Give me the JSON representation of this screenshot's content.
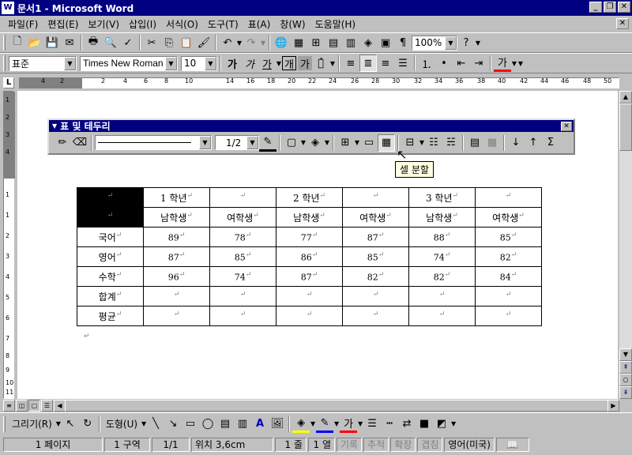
{
  "window": {
    "title": "문서1 - Microsoft Word",
    "app_icon": "W"
  },
  "menu": [
    "파일(F)",
    "편집(E)",
    "보기(V)",
    "삽입(I)",
    "서식(O)",
    "도구(T)",
    "표(A)",
    "창(W)",
    "도움말(H)"
  ],
  "standard_toolbar": {
    "zoom": "100%"
  },
  "format_toolbar": {
    "style": "표준",
    "font": "Times New Roman",
    "size": "10",
    "bold": "가",
    "italic": "가",
    "underline": "가",
    "char_border": "개",
    "char_shade": "가"
  },
  "ruler": [
    "4",
    "2",
    "2",
    "4",
    "6",
    "8",
    "10",
    "14",
    "16",
    "18",
    "20",
    "22",
    "24",
    "26",
    "28",
    "30",
    "32",
    "34",
    "36",
    "38",
    "40",
    "42",
    "44",
    "46",
    "48",
    "50"
  ],
  "vruler": [
    "1",
    "2",
    "3",
    "4",
    "1",
    "1",
    "2",
    "3",
    "4",
    "5",
    "6",
    "7",
    "8",
    "9",
    "10",
    "11"
  ],
  "tables_borders_toolbar": {
    "title": "표 및 테두리",
    "line_weight": "1/2",
    "tooltip": "셀 분할"
  },
  "document_table": {
    "rows": [
      [
        "",
        "1 학년",
        "",
        "2 학년",
        "",
        "3 학년",
        ""
      ],
      [
        "",
        "남학생",
        "여학생",
        "남학생",
        "여학생",
        "남학생",
        "여학생"
      ],
      [
        "국어",
        "89",
        "78",
        "77",
        "87",
        "88",
        "85"
      ],
      [
        "영어",
        "87",
        "85",
        "86",
        "85",
        "74",
        "82"
      ],
      [
        "수학",
        "96",
        "74",
        "87",
        "82",
        "82",
        "84"
      ],
      [
        "합계",
        "",
        "",
        "",
        "",
        "",
        ""
      ],
      [
        "평균",
        "",
        "",
        "",
        "",
        "",
        ""
      ]
    ],
    "end_of_cell_mark": "↵"
  },
  "draw_toolbar": {
    "draw": "그리기(R)",
    "autoshapes": "도형(U)"
  },
  "status_bar": {
    "page": "1 페이지",
    "section": "1 구역",
    "page_of": "1/1",
    "position": "위치 3,6cm",
    "line": "1 줄",
    "column": "1 열",
    "rec": "기록",
    "trk": "추적",
    "ext": "확장",
    "ovr": "겹침",
    "language": "영어(미국)"
  }
}
